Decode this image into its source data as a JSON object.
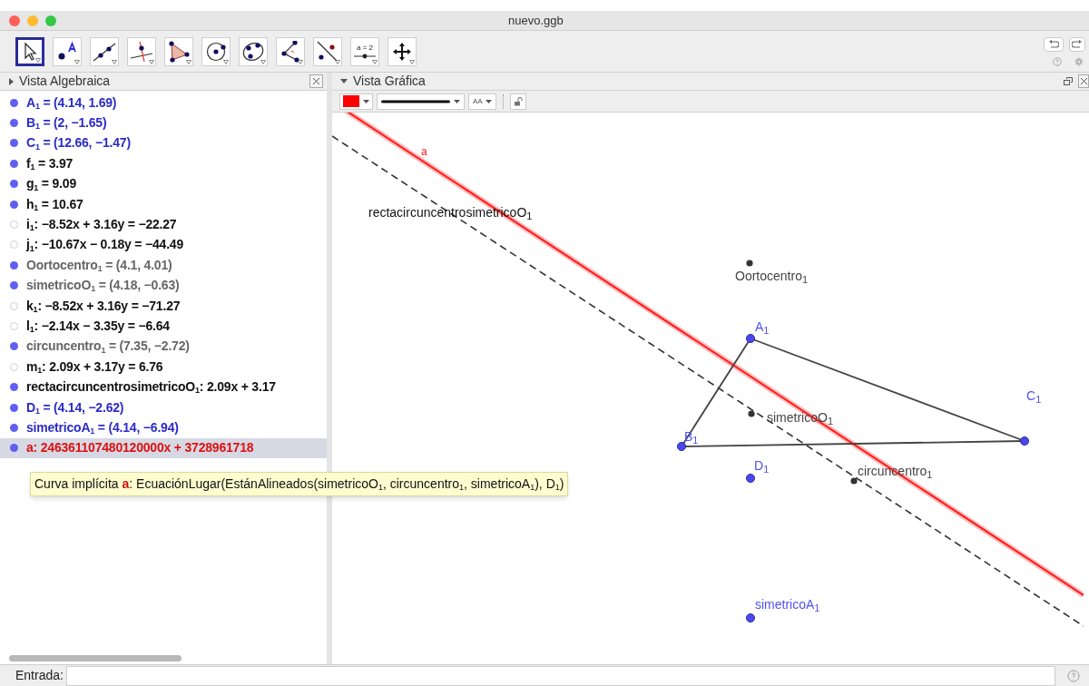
{
  "window": {
    "title": "nuevo.ggb"
  },
  "toolbar": {
    "tools": [
      {
        "kind": "pointer",
        "selected": true
      },
      {
        "kind": "point",
        "selected": false
      },
      {
        "kind": "line",
        "selected": false
      },
      {
        "kind": "perpendicular",
        "selected": false
      },
      {
        "kind": "polygon",
        "selected": false
      },
      {
        "kind": "circle",
        "selected": false
      },
      {
        "kind": "conic",
        "selected": false
      },
      {
        "kind": "angle",
        "selected": false
      },
      {
        "kind": "reflect",
        "selected": false
      },
      {
        "kind": "slider",
        "label": "a = 2",
        "selected": false
      },
      {
        "kind": "move",
        "selected": false
      }
    ]
  },
  "algebra": {
    "title": "Vista Algebraica",
    "items": [
      {
        "text": "A$_{1}$ = (4.14, 1.69)",
        "visible": true,
        "color": "#2b2bc8",
        "selected": false
      },
      {
        "text": "B$_{1}$ = (2, −1.65)",
        "visible": true,
        "color": "#2b2bc8",
        "selected": false
      },
      {
        "text": "C$_{1}$ = (12.66, −1.47)",
        "visible": true,
        "color": "#2b2bc8",
        "selected": false
      },
      {
        "text": "f$_{1}$ = 3.97",
        "visible": true,
        "color": "#111111",
        "selected": false
      },
      {
        "text": "g$_{1}$ = 9.09",
        "visible": true,
        "color": "#111111",
        "selected": false
      },
      {
        "text": "h$_{1}$ = 10.67",
        "visible": true,
        "color": "#111111",
        "selected": false
      },
      {
        "text": "i$_{1}$: −8.52x + 3.16y = −22.27",
        "visible": false,
        "color": "#111111",
        "selected": false
      },
      {
        "text": "j$_{1}$: −10.67x − 0.18y = −44.49",
        "visible": false,
        "color": "#111111",
        "selected": false
      },
      {
        "text": "Oortocentro$_{1}$ = (4.1, 4.01)",
        "visible": true,
        "color": "#666666",
        "selected": false
      },
      {
        "text": "simetricoO$_{1}$ = (4.18, −0.63)",
        "visible": true,
        "color": "#666666",
        "selected": false
      },
      {
        "text": "k$_{1}$: −8.52x + 3.16y = −71.27",
        "visible": false,
        "color": "#111111",
        "selected": false
      },
      {
        "text": "l$_{1}$: −2.14x − 3.35y = −6.64",
        "visible": false,
        "color": "#111111",
        "selected": false
      },
      {
        "text": "circuncentro$_{1}$ = (7.35, −2.72)",
        "visible": true,
        "color": "#666666",
        "selected": false
      },
      {
        "text": "m$_{1}$: 2.09x + 3.17y = 6.76",
        "visible": false,
        "color": "#111111",
        "selected": false
      },
      {
        "text": "rectacircuncentrosimetricoO$_{1}$: 2.09x + 3.17",
        "visible": true,
        "color": "#111111",
        "selected": false
      },
      {
        "text": "D$_{1}$ = (4.14, −2.62)",
        "visible": true,
        "color": "#2b2bc8",
        "selected": false
      },
      {
        "text": "simetricoA$_{1}$ = (4.14, −6.94)",
        "visible": true,
        "color": "#2b2bc8",
        "selected": false
      },
      {
        "text": "a: 246361107480120000x + 3728961718",
        "visible": true,
        "color": "#dd1111",
        "selected": true
      }
    ]
  },
  "tooltip": "Curva implícita **a**: EcuaciónLugar(EstánAlineados(simetricoO$_{1}$, circuncentro$_{1}$, simetricoA$_{1}$), D$_{1}$)",
  "graphics": {
    "title": "Vista Gráfica",
    "style_bar": {
      "color": "#ff0000",
      "label_button": "AA"
    },
    "lines": [
      {
        "kind": "solid",
        "label": "a",
        "color": "#ff1a1a"
      },
      {
        "kind": "dashed",
        "label": "rectacircuncentrosimetricoO$_{1}$",
        "color": "#333333"
      }
    ],
    "points": [
      {
        "label": "Oortocentro$_{1}$",
        "color": "#333333"
      },
      {
        "label": "A$_{1}$",
        "color": "#4848ee"
      },
      {
        "label": "C$_{1}$",
        "color": "#4848ee"
      },
      {
        "label": "simetricoO$_{1}$",
        "color": "#333333"
      },
      {
        "label": "B$_{1}$",
        "color": "#4848ee"
      },
      {
        "label": "D$_{1}$",
        "color": "#4848ee"
      },
      {
        "label": "circuncentro$_{1}$",
        "color": "#333333"
      },
      {
        "label": "simetricoA$_{1}$",
        "color": "#4848ee"
      }
    ]
  },
  "input_bar": {
    "label": "Entrada:"
  }
}
